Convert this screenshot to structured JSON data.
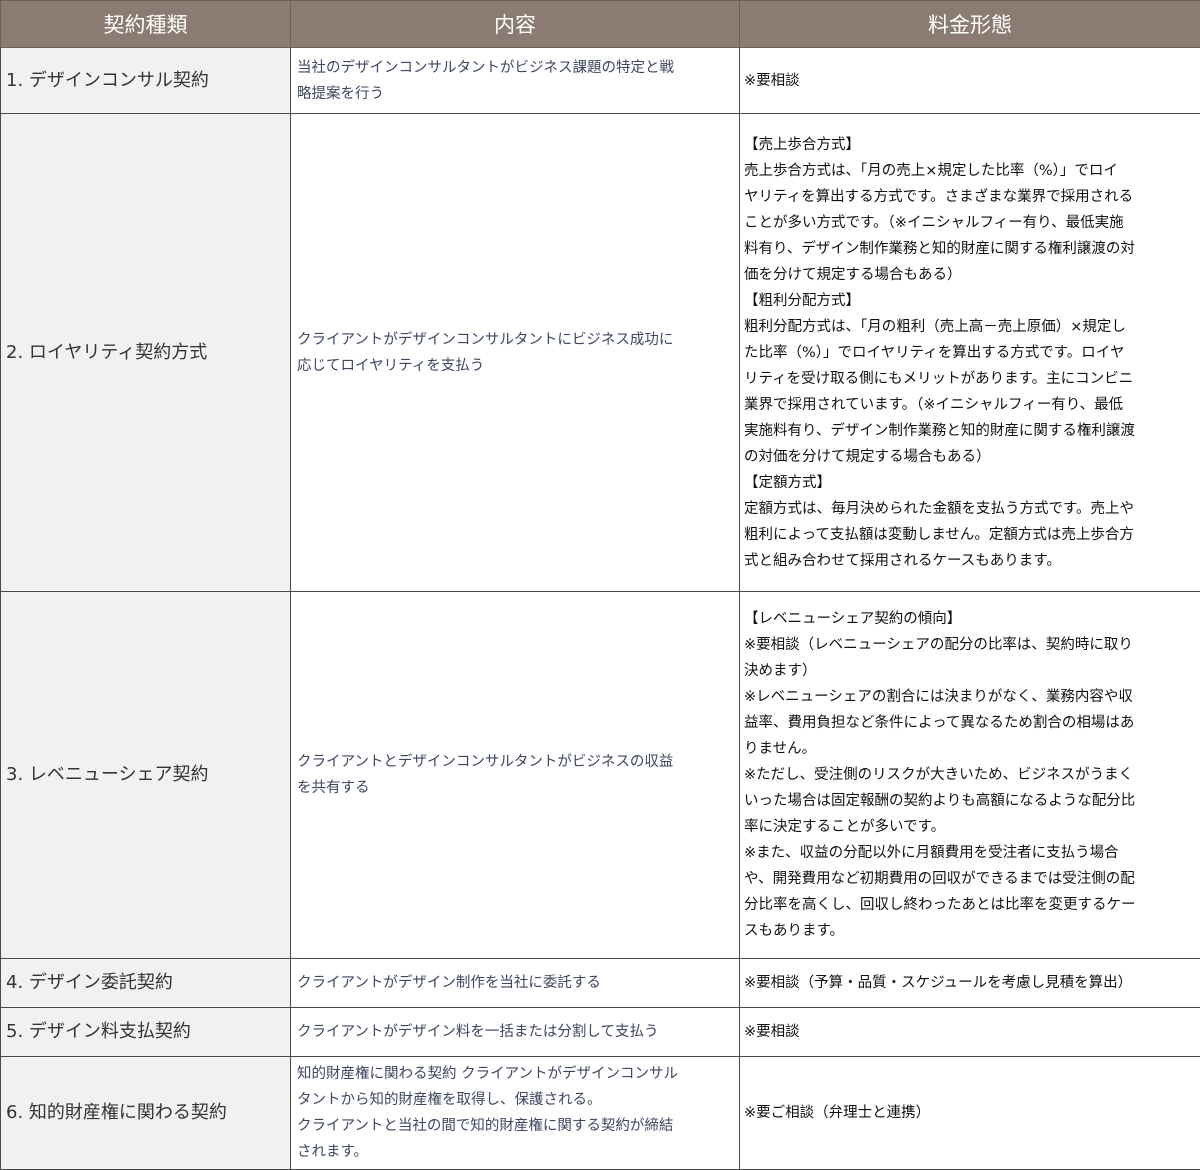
{
  "table": {
    "headers": {
      "type": "契約種類",
      "content": "内容",
      "fee": "料金形態"
    },
    "rows": [
      {
        "type": "1. デザインコンサル契約",
        "content": " 当社のデザインコンサルタントがビジネス課題の特定と戦\n略提案を行う",
        "fee": "※要相談"
      },
      {
        "type": "2. ロイヤリティ契約方式",
        "content": "クライアントがデザインコンサルタントにビジネス成功に\n応じてロイヤリティを支払う",
        "fee": "【売上歩合方式】\n売上歩合方式は、「月の売上×規定した比率（%）」でロイ\nヤリティを算出する方式です。さまざまな業界で採用される\nことが多い方式です。（※イニシャルフィー有り、最低実施\n料有り、デザイン制作業務と知的財産に関する権利譲渡の対\n価を分けて規定する場合もある）\n【粗利分配方式】\n粗利分配方式は、「月の粗利（売上高－売上原価）×規定し\nた比率（%）」でロイヤリティを算出する方式です。ロイヤ\nリティを受け取る側にもメリットがあります。主にコンビニ\n業界で採用されています。（※イニシャルフィー有り、最低\n実施料有り、デザイン制作業務と知的財産に関する権利譲渡\nの対価を分けて規定する場合もある）\n【定額方式】\n定額方式は、毎月決められた金額を支払う方式です。売上や\n粗利によって支払額は変動しません。定額方式は売上歩合方\n式と組み合わせて採用されるケースもあります。"
      },
      {
        "type": "3. レベニューシェア契約",
        "content": "クライアントとデザインコンサルタントがビジネスの収益\nを共有する",
        "fee": "【レベニューシェア契約の傾向】\n※要相談（レベニューシェアの配分の比率は、契約時に取り\n決めます）\n※レベニューシェアの割合には決まりがなく、業務内容や収\n益率、費用負担など条件によって異なるため割合の相場はあ\nりません。\n※ただし、受注側のリスクが大きいため、ビジネスがうまく\nいった場合は固定報酬の契約よりも高額になるような配分比\n率に決定することが多いです。\n※また、収益の分配以外に月額費用を受注者に支払う場合\nや、開発費用など初期費用の回収ができるまでは受注側の配\n分比率を高くし、回収し終わったあとは比率を変更するケー\nスもあります。"
      },
      {
        "type": "4. デザイン委託契約",
        "content": "クライアントがデザイン制作を当社に委託する",
        "fee": "※要相談（予算・品質・スケジュールを考慮し見積を算出）"
      },
      {
        "type": "5. デザイン料支払契約",
        "content": "クライアントがデザイン料を一括または分割して支払う",
        "fee": "※要相談"
      },
      {
        "type": "6. 知的財産権に関わる契約",
        "content": "知的財産権に関わる契約 クライアントがデザインコンサル\nタントから知的財産権を取得し、保護される。\nクライアントと当社の間で知的財産権に関する契約が締結\nされます。",
        "fee": "※要ご相談（弁理士と連携）"
      }
    ]
  }
}
